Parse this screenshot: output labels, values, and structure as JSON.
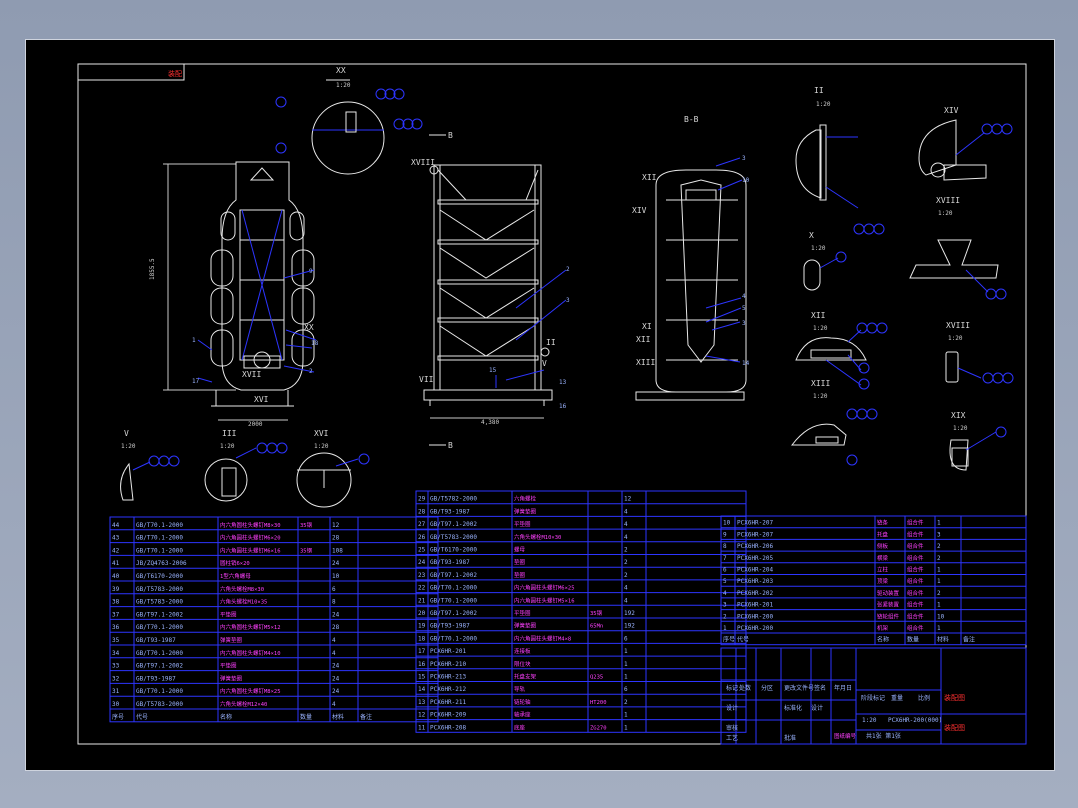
{
  "drawing": {
    "title_block_red": "装配",
    "view_labels": {
      "A": "A-A",
      "B": "B-B"
    },
    "section_marks": [
      "XX",
      "II",
      "XIV",
      "XVIII",
      "X",
      "XII",
      "XIII",
      "XVIII",
      "V",
      "III",
      "XVI",
      "XIX"
    ],
    "side_labels": [
      "XVIII",
      "XII",
      "XIV",
      "XI",
      "XIII",
      "XVII",
      "XVI",
      "VI",
      "XX",
      "IV",
      "IX"
    ],
    "dims": {
      "height": "1855.5",
      "width_left": "2000",
      "width_mid": "4,380"
    },
    "scales": [
      "1:20",
      "1:20",
      "1:20",
      "1:20",
      "1:20",
      "1:20",
      "1:20",
      "1:20",
      "1:20",
      "1:20",
      "1:20",
      "1:20"
    ]
  },
  "bom_left": [
    {
      "no": "44",
      "code": "GB/T70.1-2000",
      "name": "内六角圆柱头螺钉M8×30",
      "mat": "35钢",
      "qty": "12"
    },
    {
      "no": "43",
      "code": "GB/T70.1-2000",
      "name": "内六角圆柱头螺钉M6×20",
      "mat": "",
      "qty": "28"
    },
    {
      "no": "42",
      "code": "GB/T70.1-2000",
      "name": "内六角圆柱头螺钉M6×16",
      "mat": "35钢",
      "qty": "108"
    },
    {
      "no": "41",
      "code": "JB/ZQ4763-2006",
      "name": "圆柱销6×20",
      "mat": "",
      "qty": "24"
    },
    {
      "no": "40",
      "code": "GB/T6170-2000",
      "name": "1型六角螺母",
      "mat": "",
      "qty": "10"
    },
    {
      "no": "39",
      "code": "GB/T5783-2000",
      "name": "六角头螺栓M8×30",
      "mat": "",
      "qty": "6"
    },
    {
      "no": "38",
      "code": "GB/T5783-2000",
      "name": "六角头螺栓M10×35",
      "mat": "",
      "qty": "8"
    },
    {
      "no": "37",
      "code": "GB/T97.1-2002",
      "name": "平垫圈",
      "mat": "",
      "qty": "24"
    },
    {
      "no": "36",
      "code": "GB/T70.1-2000",
      "name": "内六角圆柱头螺钉M5×12",
      "mat": "",
      "qty": "28"
    },
    {
      "no": "35",
      "code": "GB/T93-1987",
      "name": "弹簧垫圈",
      "mat": "",
      "qty": "4"
    },
    {
      "no": "34",
      "code": "GB/T70.1-2000",
      "name": "内六角圆柱头螺钉M4×10",
      "mat": "",
      "qty": "4"
    },
    {
      "no": "33",
      "code": "GB/T97.1-2002",
      "name": "平垫圈",
      "mat": "",
      "qty": "24"
    },
    {
      "no": "32",
      "code": "GB/T93-1987",
      "name": "弹簧垫圈",
      "mat": "",
      "qty": "24"
    },
    {
      "no": "31",
      "code": "GB/T70.1-2000",
      "name": "内六角圆柱头螺钉M8×25",
      "mat": "",
      "qty": "24"
    },
    {
      "no": "30",
      "code": "GB/T5783-2000",
      "name": "六角头螺栓M12×40",
      "mat": "",
      "qty": "4"
    }
  ],
  "bom_left_header": [
    "序号",
    "代号",
    "名称",
    "数量",
    "材料",
    "备注"
  ],
  "bom_mid": [
    {
      "no": "29",
      "code": "GB/T5782-2000",
      "name": "六角螺栓",
      "mat": "",
      "qty": "12"
    },
    {
      "no": "28",
      "code": "GB/T93-1987",
      "name": "弹簧垫圈",
      "mat": "",
      "qty": "4"
    },
    {
      "no": "27",
      "code": "GB/T97.1-2002",
      "name": "平垫圈",
      "mat": "",
      "qty": "4"
    },
    {
      "no": "26",
      "code": "GB/T5783-2000",
      "name": "六角头螺栓M10×30",
      "mat": "",
      "qty": "4"
    },
    {
      "no": "25",
      "code": "GB/T6170-2000",
      "name": "螺母",
      "mat": "",
      "qty": "2"
    },
    {
      "no": "24",
      "code": "GB/T93-1987",
      "name": "垫圈",
      "mat": "",
      "qty": "2"
    },
    {
      "no": "23",
      "code": "GB/T97.1-2002",
      "name": "垫圈",
      "mat": "",
      "qty": "2"
    },
    {
      "no": "22",
      "code": "GB/T70.1-2000",
      "name": "内六角圆柱头螺钉M6×25",
      "mat": "",
      "qty": "4"
    },
    {
      "no": "21",
      "code": "GB/T70.1-2000",
      "name": "内六角圆柱头螺钉M5×16",
      "mat": "",
      "qty": "4"
    },
    {
      "no": "20",
      "code": "GB/T97.1-2002",
      "name": "平垫圈",
      "mat": "35钢",
      "qty": "192"
    },
    {
      "no": "19",
      "code": "GB/T93-1987",
      "name": "弹簧垫圈",
      "mat": "65Mn",
      "qty": "192"
    },
    {
      "no": "18",
      "code": "GB/T70.1-2000",
      "name": "内六角圆柱头螺钉M4×8",
      "mat": "",
      "qty": "6"
    },
    {
      "no": "17",
      "code": "PCX6HR-201",
      "name": "连接板",
      "mat": "",
      "qty": "1"
    },
    {
      "no": "16",
      "code": "PCX6HR-210",
      "name": "限位块",
      "mat": "",
      "qty": "1"
    },
    {
      "no": "15",
      "code": "PCX6HR-213",
      "name": "托盘支架",
      "mat": "Q235",
      "qty": "1"
    },
    {
      "no": "14",
      "code": "PCX6HR-212",
      "name": "导轨",
      "mat": "",
      "qty": "6"
    },
    {
      "no": "13",
      "code": "PCX6HR-211",
      "name": "链轮轴",
      "mat": "HT200",
      "qty": "2"
    },
    {
      "no": "12",
      "code": "PCX6HR-209",
      "name": "轴承座",
      "mat": "",
      "qty": "1"
    },
    {
      "no": "11",
      "code": "PCX6HR-208",
      "name": "底座",
      "mat": "ZG270",
      "qty": "1"
    }
  ],
  "bom_right": [
    {
      "no": "10",
      "code": "PCX6HR-207",
      "name": "链条",
      "mat": "组合件",
      "qty": "1"
    },
    {
      "no": "9",
      "code": "PCX6HR-207",
      "name": "托盘",
      "mat": "组合件",
      "qty": "3"
    },
    {
      "no": "8",
      "code": "PCX6HR-206",
      "name": "侧板",
      "mat": "组合件",
      "qty": "2"
    },
    {
      "no": "7",
      "code": "PCX6HR-205",
      "name": "横梁",
      "mat": "组合件",
      "qty": "2"
    },
    {
      "no": "6",
      "code": "PCX6HR-204",
      "name": "立柱",
      "mat": "组合件",
      "qty": "1"
    },
    {
      "no": "5",
      "code": "PCX6HR-203",
      "name": "顶梁",
      "mat": "组合件",
      "qty": "1"
    },
    {
      "no": "4",
      "code": "PCX6HR-202",
      "name": "驱动装置",
      "mat": "组合件",
      "qty": "2"
    },
    {
      "no": "3",
      "code": "PCX6HR-201",
      "name": "张紧装置",
      "mat": "组合件",
      "qty": "1"
    },
    {
      "no": "2",
      "code": "PCX6HR-200",
      "name": "链轮组件",
      "mat": "组合件",
      "qty": "10"
    },
    {
      "no": "1",
      "code": "PCX6HR-200",
      "name": "机架",
      "mat": "组合件",
      "qty": "1"
    }
  ],
  "bom_right_header": [
    "序号",
    "代号",
    "名称",
    "数量",
    "材料",
    "备注"
  ],
  "title_block": {
    "drawing_name": "装配图",
    "drawing_no": "PCX6HR-200(000)",
    "company": "设计",
    "scale": "1:20",
    "sheet": "共1张 第1张",
    "red_label": "装配图",
    "cells": [
      "标记",
      "处数",
      "分区",
      "更改文件号",
      "签名",
      "年月日",
      "设计",
      "标准化",
      "审核",
      "工艺",
      "批准",
      "阶段标记",
      "重量",
      "比例"
    ],
    "mag_label": "图纸编号"
  }
}
